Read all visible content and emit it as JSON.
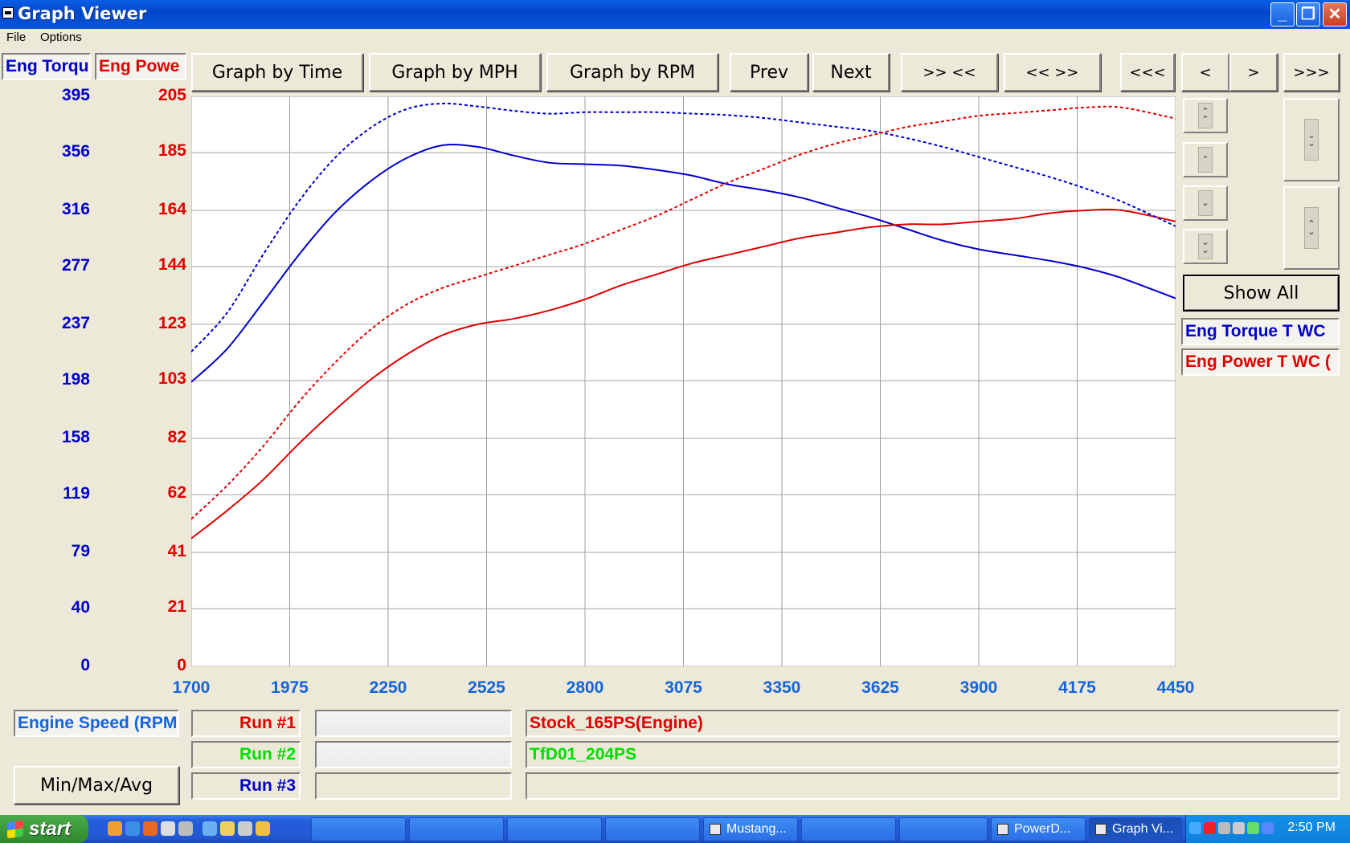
{
  "window": {
    "title": "Graph Viewer"
  },
  "menu": [
    "File",
    "Options"
  ],
  "channel_tabs": {
    "torque": "Eng Torqu",
    "power": "Eng Powe"
  },
  "toolbar": {
    "graph_by_time": "Graph by Time",
    "graph_by_mph": "Graph by MPH",
    "graph_by_rpm": "Graph by RPM",
    "prev": "Prev",
    "next": "Next",
    "zoom_in": ">> <<",
    "zoom_out": "<< >>",
    "scroll_far_left": "<<<",
    "scroll_left": "<",
    "scroll_right": ">",
    "scroll_far_right": ">>>"
  },
  "side_panel": {
    "show_all": "Show All",
    "legend_torque": "Eng Torque T WC",
    "legend_power": "Eng Power T WC ("
  },
  "x_axis_label": "Engine Speed (RPM",
  "min_max_avg": "Min/Max/Avg",
  "runs": [
    {
      "label": "Run #1",
      "name": "Stock_165PS(Engine)",
      "color": "#e00000"
    },
    {
      "label": "Run #2",
      "name": "TfD01_204PS",
      "color": "#00dd00"
    },
    {
      "label": "Run #3",
      "name": "",
      "color": "#0000cc"
    }
  ],
  "colors": {
    "torque": "#0000cc",
    "power": "#e00000",
    "axis_x": "#1464dc"
  },
  "taskbar": {
    "start": "start",
    "tasks": [
      "Mustang...",
      "PowerD...",
      "Graph Vi..."
    ],
    "clock": "2:50 PM"
  },
  "chart_data": {
    "type": "line",
    "x_ticks": [
      1700,
      1975,
      2250,
      2525,
      2800,
      3075,
      3350,
      3625,
      3900,
      4175,
      4450
    ],
    "xlim": [
      1700,
      4450
    ],
    "y_left": {
      "ticks": [
        0,
        40,
        79,
        119,
        158,
        198,
        237,
        277,
        316,
        356,
        395
      ],
      "lim": [
        0,
        395
      ]
    },
    "y_right": {
      "ticks": [
        0,
        21,
        41,
        62,
        82,
        103,
        123,
        144,
        164,
        185,
        205
      ],
      "lim": [
        0,
        205
      ]
    },
    "grid": true,
    "series": [
      {
        "name": "Eng Torque T WC",
        "run": "Run #1",
        "axis": "left",
        "style": "solid",
        "x": [
          1700,
          1800,
          1900,
          2000,
          2100,
          2200,
          2300,
          2400,
          2500,
          2600,
          2700,
          2800,
          2900,
          3000,
          3100,
          3200,
          3300,
          3400,
          3500,
          3600,
          3700,
          3800,
          3900,
          4000,
          4100,
          4200,
          4300,
          4450
        ],
        "y": [
          197,
          220,
          252,
          285,
          314,
          336,
          352,
          361,
          360,
          354,
          349,
          348,
          347,
          344,
          340,
          334,
          330,
          325,
          318,
          311,
          303,
          295,
          289,
          285,
          281,
          276,
          269,
          255
        ]
      },
      {
        "name": "Eng Power T WC",
        "run": "Run #1",
        "axis": "right",
        "style": "solid",
        "x": [
          1700,
          1800,
          1900,
          2000,
          2100,
          2200,
          2300,
          2400,
          2500,
          2600,
          2700,
          2800,
          2900,
          3000,
          3100,
          3200,
          3300,
          3400,
          3500,
          3600,
          3700,
          3800,
          3900,
          4000,
          4100,
          4200,
          4300,
          4450
        ],
        "y": [
          46,
          56,
          67,
          80,
          92,
          103,
          112,
          119,
          123,
          125,
          128,
          132,
          137,
          141,
          145,
          148,
          151,
          154,
          156,
          158,
          159,
          159,
          160,
          161,
          163,
          164,
          164,
          160
        ]
      },
      {
        "name": "Eng Torque T WC",
        "run": "Run #2",
        "axis": "left",
        "style": "dashed",
        "x": [
          1700,
          1800,
          1900,
          2000,
          2100,
          2200,
          2300,
          2400,
          2500,
          2600,
          2700,
          2800,
          2900,
          3000,
          3100,
          3200,
          3300,
          3400,
          3500,
          3600,
          3700,
          3800,
          3900,
          4000,
          4100,
          4200,
          4300,
          4450
        ],
        "y": [
          218,
          245,
          285,
          322,
          352,
          373,
          386,
          390,
          388,
          385,
          383,
          384,
          384,
          384,
          383,
          382,
          380,
          377,
          374,
          371,
          366,
          360,
          353,
          346,
          339,
          331,
          322,
          305
        ]
      },
      {
        "name": "Eng Power T WC",
        "run": "Run #2",
        "axis": "right",
        "style": "dashed",
        "x": [
          1700,
          1800,
          1900,
          2000,
          2100,
          2200,
          2300,
          2400,
          2500,
          2600,
          2700,
          2800,
          2900,
          3000,
          3100,
          3200,
          3300,
          3400,
          3500,
          3600,
          3700,
          3800,
          3900,
          4000,
          4100,
          4200,
          4300,
          4450
        ],
        "y": [
          53,
          65,
          79,
          95,
          109,
          121,
          130,
          136,
          140,
          144,
          148,
          152,
          157,
          162,
          168,
          174,
          179,
          184,
          188,
          191,
          194,
          196,
          198,
          199,
          200,
          201,
          201,
          197
        ]
      }
    ]
  }
}
